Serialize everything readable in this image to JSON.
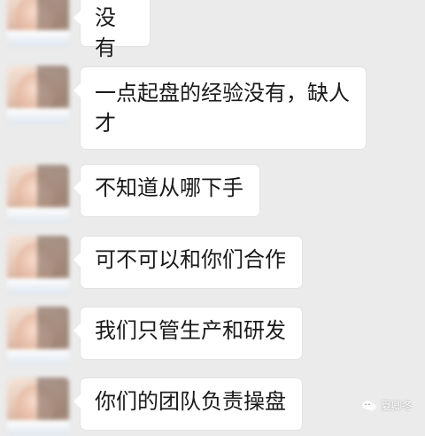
{
  "messages": [
    {
      "text": "没有"
    },
    {
      "text": "一点起盘的经验没有，缺人才"
    },
    {
      "text": "不知道从哪下手"
    },
    {
      "text": "可不可以和你们合作"
    },
    {
      "text": "我们只管生产和研发"
    },
    {
      "text": "你们的团队负责操盘"
    }
  ],
  "watermark": {
    "icon": "wechat-icon",
    "label": "夏卿冬"
  }
}
